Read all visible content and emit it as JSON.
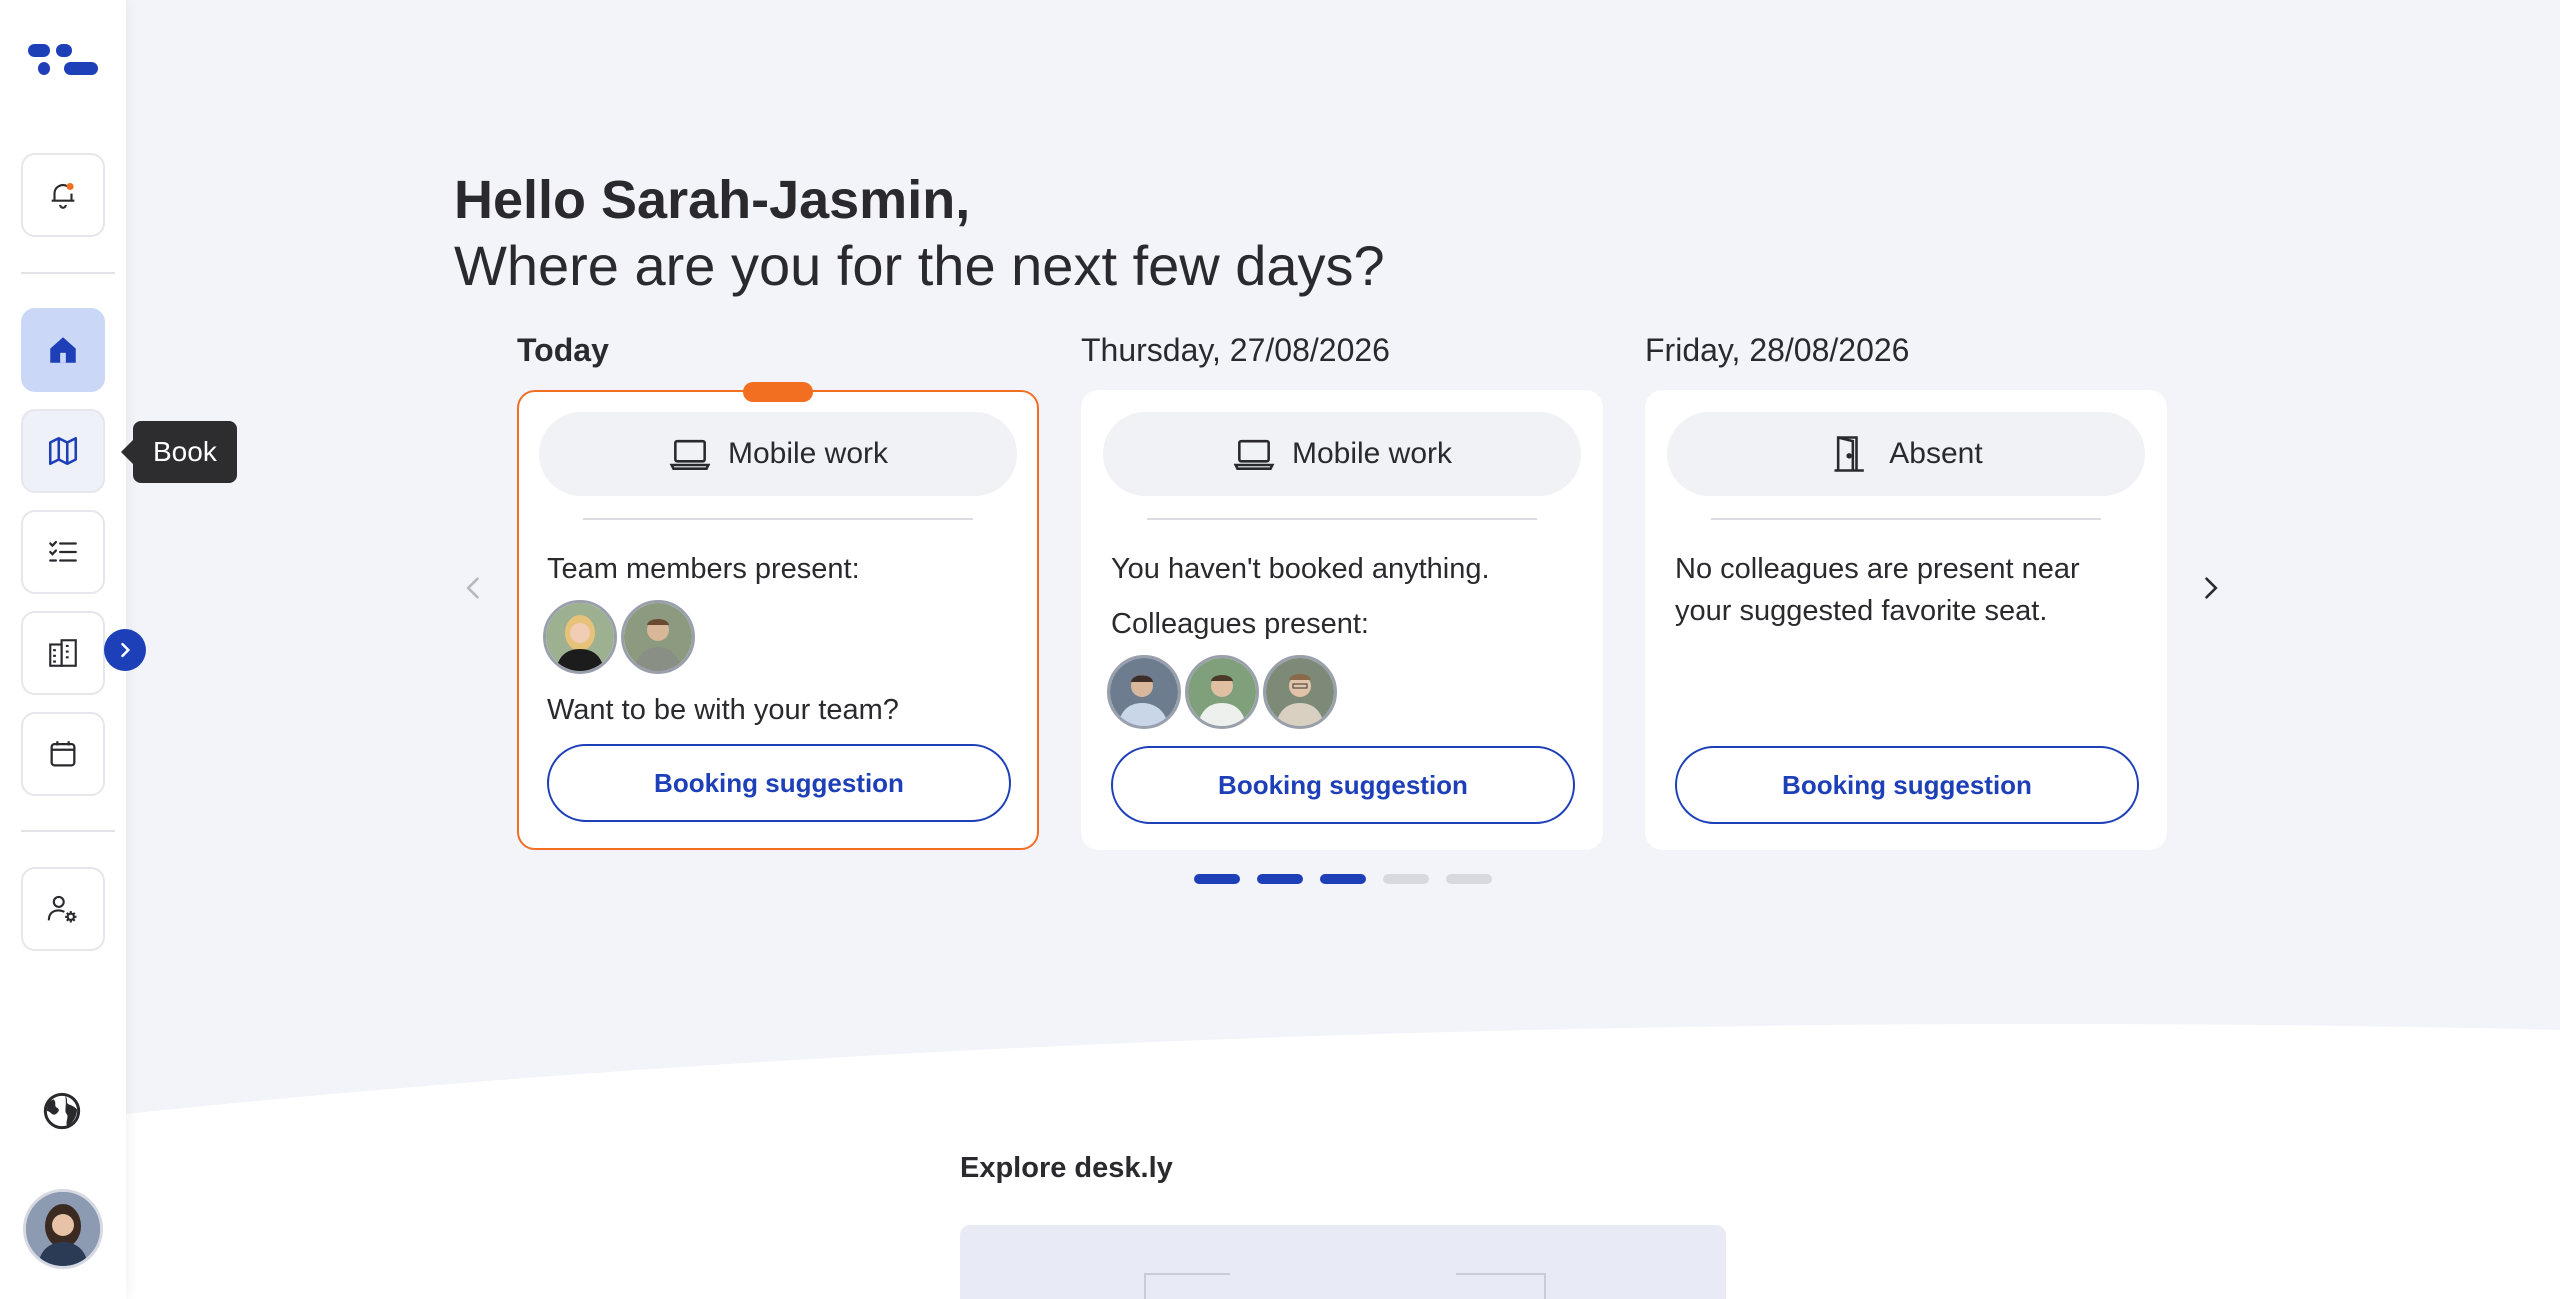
{
  "greeting": {
    "hello": "Hello Sarah-Jasmin,",
    "question": "Where are you for the next few days?"
  },
  "sidebar": {
    "tooltip": "Book",
    "items": [
      "notifications",
      "home",
      "book",
      "tasks",
      "buildings",
      "calendar",
      "admin-settings"
    ]
  },
  "days": [
    {
      "label": "Today",
      "status": "Mobile work",
      "status_icon": "laptop-icon",
      "line1": "Team members present:",
      "line2": "Want to be with your team?",
      "button": "Booking suggestion"
    },
    {
      "label": "Thursday, 27/08/2026",
      "status": "Mobile work",
      "status_icon": "laptop-icon",
      "line1": "You haven't booked anything.",
      "line2": "Colleagues present:",
      "button": "Booking suggestion"
    },
    {
      "label": "Friday, 28/08/2026",
      "status": "Absent",
      "status_icon": "door-icon",
      "line1": "No colleagues are present near your suggested favorite seat.",
      "button": "Booking suggestion"
    }
  ],
  "pagination": {
    "total": 5,
    "active": 3
  },
  "explore": {
    "title": "Explore desk.ly"
  },
  "colors": {
    "accent": "#1d3fb8",
    "today_border": "#f26f22",
    "background": "#f3f4f9"
  }
}
